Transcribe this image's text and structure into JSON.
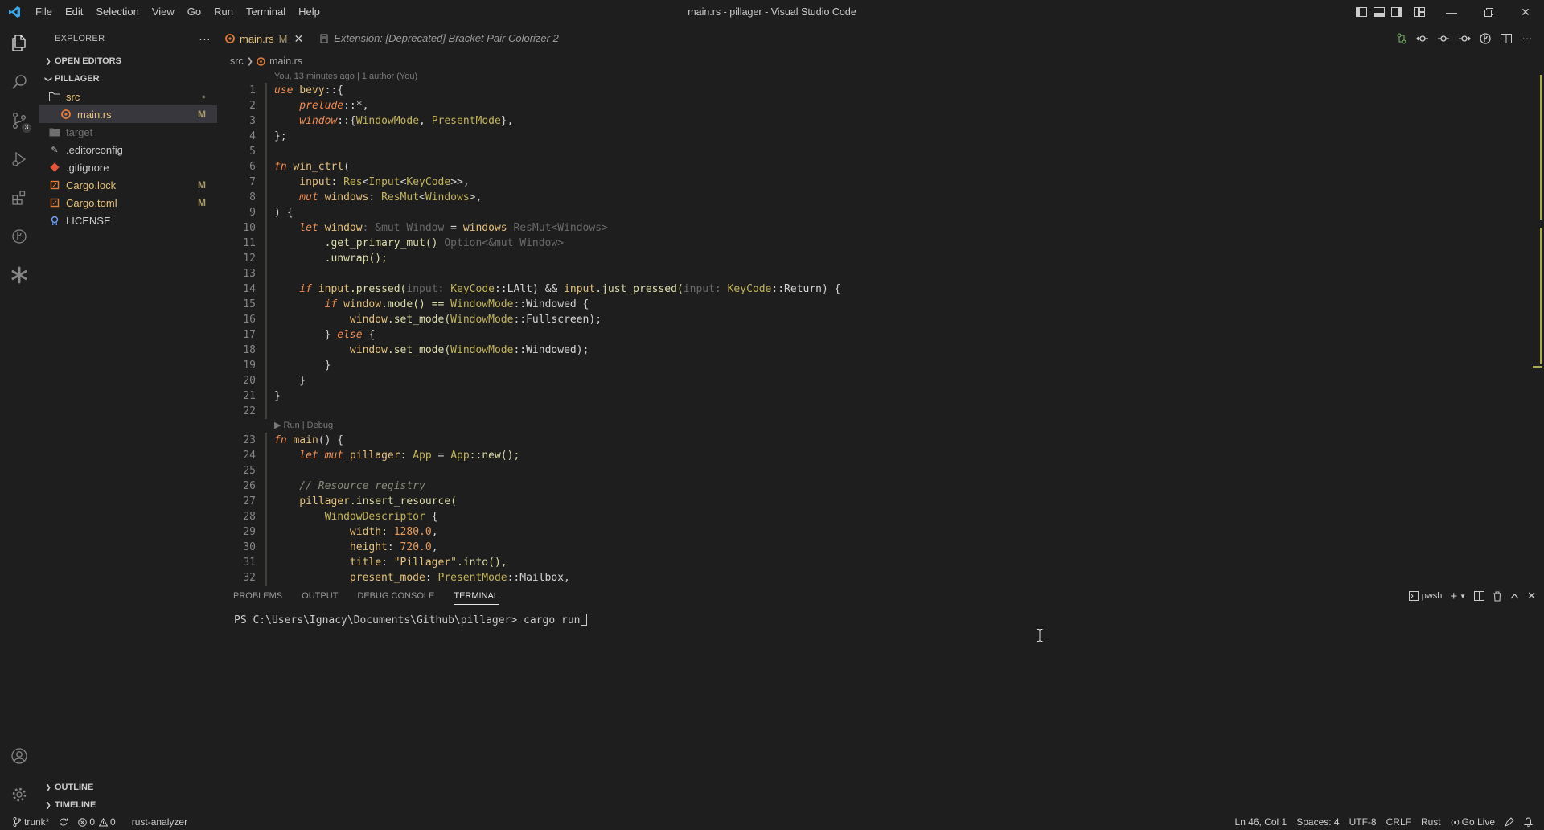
{
  "titlebar": {
    "menu": [
      "File",
      "Edit",
      "Selection",
      "View",
      "Go",
      "Run",
      "Terminal",
      "Help"
    ],
    "title": "main.rs - pillager - Visual Studio Code"
  },
  "sidebar": {
    "header": "EXPLORER",
    "open_editors": "OPEN EDITORS",
    "project": "PILLAGER",
    "items": [
      {
        "label": "src",
        "status": "●"
      },
      {
        "label": "main.rs",
        "status": "M"
      },
      {
        "label": "target",
        "status": ""
      },
      {
        "label": ".editorconfig",
        "status": ""
      },
      {
        "label": ".gitignore",
        "status": ""
      },
      {
        "label": "Cargo.lock",
        "status": "M"
      },
      {
        "label": "Cargo.toml",
        "status": "M"
      },
      {
        "label": "LICENSE",
        "status": ""
      }
    ],
    "outline": "OUTLINE",
    "timeline": "TIMELINE"
  },
  "activity": {
    "scm_badge": "3"
  },
  "tabs": {
    "active_label": "main.rs",
    "active_status": "M",
    "preview_label": "Extension: [Deprecated] Bracket Pair Colorizer 2"
  },
  "breadcrumbs": {
    "folder": "src",
    "file": "main.rs"
  },
  "editor": {
    "blame": "You, 13 minutes ago | 1 author (You)",
    "codelens": "▶ Run | Debug",
    "line_numbers": [
      "1",
      "2",
      "3",
      "4",
      "5",
      "6",
      "7",
      "8",
      "9",
      "10",
      "11",
      "12",
      "13",
      "14",
      "15",
      "16",
      "17",
      "18",
      "19",
      "20",
      "21",
      "22",
      "23",
      "24",
      "25",
      "26",
      "27",
      "28",
      "29",
      "30",
      "31",
      "32"
    ],
    "lines": {
      "l1a": "use",
      "l1b": " bevy",
      "l1c": "::{",
      "l2a": "    prelude",
      "l2b": "::*,",
      "l3a": "    window",
      "l3b": "::{",
      "l3c": "WindowMode",
      "l3d": ", ",
      "l3e": "PresentMode",
      "l3f": "},",
      "l4": "};",
      "l5": "",
      "l6a": "fn",
      "l6b": " win_ctrl",
      "l6c": "(",
      "l7a": "    input",
      "l7b": ": ",
      "l7c": "Res",
      "l7d": "<",
      "l7e": "Input",
      "l7f": "<",
      "l7g": "KeyCode",
      "l7h": ">>,",
      "l8a": "    mut",
      "l8b": " windows",
      "l8c": ": ",
      "l8d": "ResMut",
      "l8e": "<",
      "l8f": "Windows",
      "l8g": ">,",
      "l9": ") {",
      "l10a": "    let",
      "l10b": " window",
      "l10c": ": &mut Window",
      "l10d": " = ",
      "l10e": "windows",
      "l10f": " ResMut<Windows>",
      "l11a": "        .get_primary_mut()",
      "l11b": " Option<&mut Window>",
      "l12": "        .unwrap();",
      "l13": "",
      "l14a": "    if",
      "l14b": " input",
      "l14c": ".pressed(",
      "l14d": "input: ",
      "l14e": "KeyCode",
      "l14f": "::LAlt) && ",
      "l14g": "input",
      "l14h": ".just_pressed(",
      "l14i": "input: ",
      "l14j": "KeyCode",
      "l14k": "::Return) {",
      "l15a": "        if",
      "l15b": " window",
      "l15c": ".mode() == ",
      "l15d": "WindowMode",
      "l15e": "::Windowed {",
      "l16a": "            window",
      "l16b": ".set_mode(",
      "l16c": "WindowMode",
      "l16d": "::Fullscreen);",
      "l17a": "        } ",
      "l17b": "else",
      "l17c": " {",
      "l18a": "            window",
      "l18b": ".set_mode(",
      "l18c": "WindowMode",
      "l18d": "::Windowed);",
      "l19": "        }",
      "l20": "    }",
      "l21": "}",
      "l22": "",
      "l23a": "fn",
      "l23b": " main",
      "l23c": "() {",
      "l24a": "    let",
      "l24b": " mut",
      "l24c": " pillager",
      "l24d": ": ",
      "l24e": "App",
      "l24f": " = ",
      "l24g": "App",
      "l24h": "::new();",
      "l25": "",
      "l26": "    // Resource registry",
      "l27a": "    pillager",
      "l27b": ".insert_resource(",
      "l28a": "        WindowDescriptor",
      "l28b": " {",
      "l29a": "            width",
      "l29b": ": ",
      "l29c": "1280.0",
      "l29d": ",",
      "l30a": "            height",
      "l30b": ": ",
      "l30c": "720.0",
      "l30d": ",",
      "l31a": "            title",
      "l31b": ": ",
      "l31c": "\"Pillager\"",
      "l31d": ".into(),",
      "l32a": "            present_mode",
      "l32b": ": ",
      "l32c": "PresentMode",
      "l32d": "::Mailbox,"
    }
  },
  "panel": {
    "tabs": [
      "PROBLEMS",
      "OUTPUT",
      "DEBUG CONSOLE",
      "TERMINAL"
    ],
    "shell": "pwsh",
    "prompt": "PS C:\\Users\\Ignacy\\Documents\\Github\\pillager> ",
    "command": "cargo run"
  },
  "statusbar": {
    "branch": "trunk*",
    "errors": "0",
    "warnings": "0",
    "lang_server": "rust-analyzer",
    "position": "Ln 46, Col 1",
    "spaces": "Spaces: 4",
    "encoding": "UTF-8",
    "eol": "CRLF",
    "language": "Rust",
    "golive": "Go Live"
  },
  "colors": {
    "background": "#1e1e1e",
    "keyword": "#f28b50",
    "identifier": "#e5c07b",
    "type": "#c3b35c",
    "line_number": "#858585"
  }
}
